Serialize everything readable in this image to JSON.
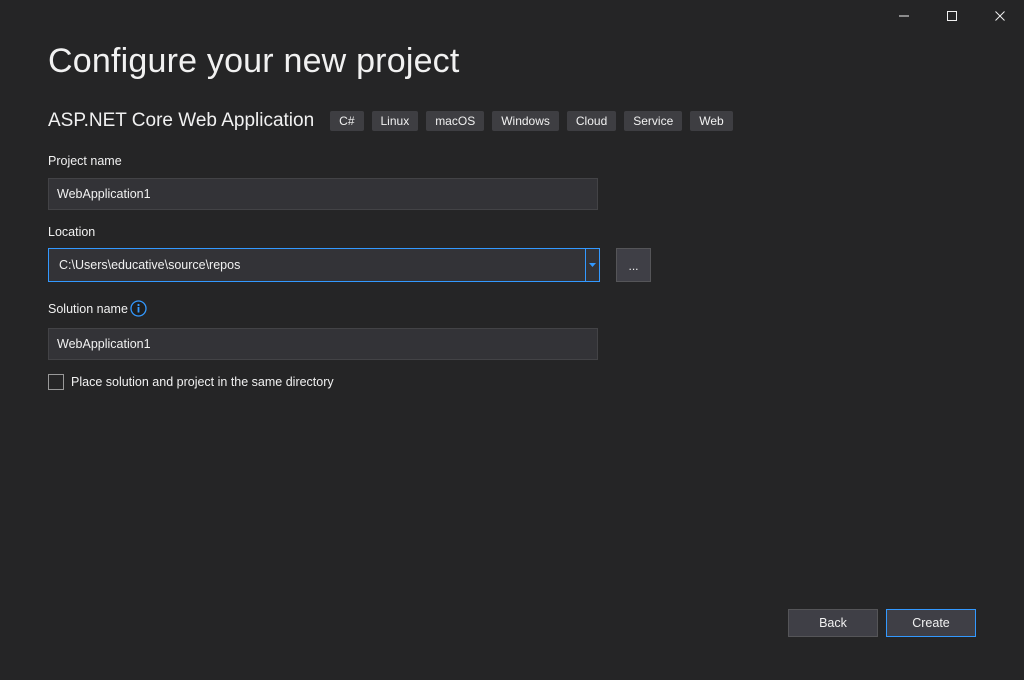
{
  "window": {
    "caption_buttons": [
      "minimize-icon",
      "maximize-icon",
      "close-icon"
    ]
  },
  "page": {
    "title": "Configure your new project"
  },
  "template": {
    "name": "ASP.NET Core Web Application",
    "tags": [
      "C#",
      "Linux",
      "macOS",
      "Windows",
      "Cloud",
      "Service",
      "Web"
    ]
  },
  "form": {
    "project_name": {
      "label": "Project name",
      "value": "WebApplication1"
    },
    "location": {
      "label": "Location",
      "value": "C:\\Users\\educative\\source\\repos",
      "browse_label": "..."
    },
    "solution_name": {
      "label": "Solution name",
      "value": "WebApplication1",
      "info_icon": "info-icon"
    },
    "same_directory": {
      "label": "Place solution and project in the same directory",
      "checked": false
    }
  },
  "footer": {
    "back_label": "Back",
    "create_label": "Create"
  },
  "colors": {
    "background": "#252526",
    "accent": "#3399ff",
    "input_bg": "#333337",
    "tag_bg": "#3e3e42"
  }
}
